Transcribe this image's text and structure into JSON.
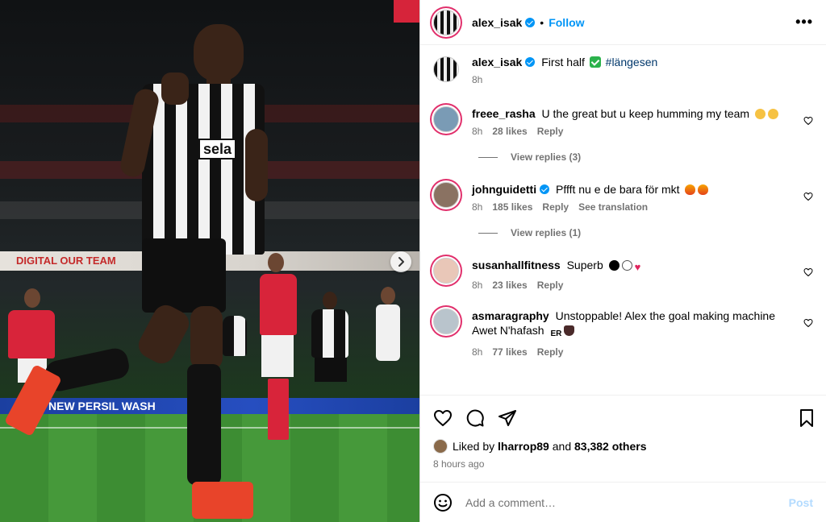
{
  "post": {
    "author": "alex_isak",
    "follow_label": "Follow",
    "separator": "•",
    "more_label": "•••"
  },
  "caption": {
    "user": "alex_isak",
    "text": "First half",
    "hashtag": "#längesen",
    "time": "8h"
  },
  "comments": [
    {
      "user": "freee_rasha",
      "text": "U the great but u keep humming my team",
      "time": "8h",
      "likes": "28 likes",
      "reply": "Reply",
      "view_replies": "View replies (3)"
    },
    {
      "user": "johnguidetti",
      "text": "Pffft nu e de bara för mkt",
      "time": "8h",
      "likes": "185 likes",
      "reply": "Reply",
      "translate": "See translation",
      "view_replies": "View replies (1)"
    },
    {
      "user": "susanhallfitness",
      "text": "Superb",
      "time": "8h",
      "likes": "23 likes",
      "reply": "Reply"
    },
    {
      "user": "asmaragraphy",
      "text": "Unstoppable! Alex the goal making machine Awet N'hafash",
      "flag": "ER",
      "time": "8h",
      "likes": "77 likes",
      "reply": "Reply"
    }
  ],
  "likes": {
    "prefix": "Liked by",
    "user": "lharrop89",
    "connector": "and",
    "others": "83,382 others",
    "time_ago": "8 hours ago"
  },
  "add_comment": {
    "placeholder": "Add a comment…",
    "post_label": "Post"
  },
  "media": {
    "sponsor_text": "sela",
    "board_text_1": "DIGITAL OUR TEAM",
    "board_text_2": "NEW PERSIL WASH"
  },
  "colors": {
    "accent": "#0095f6",
    "post_disabled": "#b3dbff",
    "secondary_text": "#737373"
  }
}
